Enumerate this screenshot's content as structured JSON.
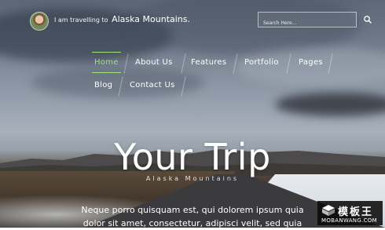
{
  "header": {
    "tagline_prefix": "I am travelling to",
    "destination": "Alaska Mountains.",
    "search_placeholder": "Search Here..."
  },
  "nav": {
    "items": [
      {
        "label": "Home",
        "active": true
      },
      {
        "label": "About Us",
        "active": false
      },
      {
        "label": "Features",
        "active": false
      },
      {
        "label": "Portfolio",
        "active": false
      },
      {
        "label": "Pages",
        "active": false
      },
      {
        "label": "Blog",
        "active": false
      },
      {
        "label": "Contact Us",
        "active": false
      }
    ]
  },
  "hero": {
    "title": "Your Trip",
    "subtitle": "Alaska Mountains",
    "description": "Neque porro quisquam est, qui dolorem ipsum quia dolor sit amet, consectetur, adipisci velit, sed quia"
  },
  "watermark": {
    "chinese_text": "模板王",
    "url": "MOBANWANG.COM"
  },
  "colors": {
    "active_nav": "#9fe37c",
    "text": "#ffffff"
  }
}
